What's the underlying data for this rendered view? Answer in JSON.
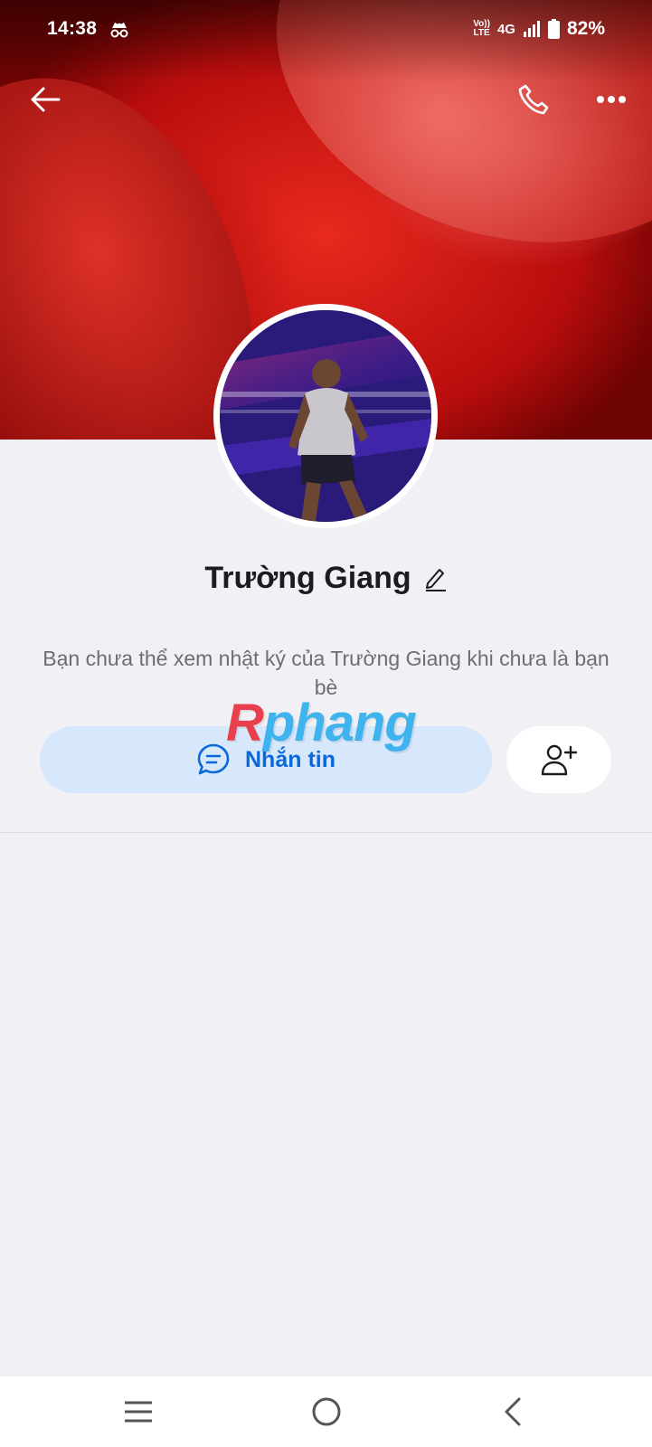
{
  "status_bar": {
    "time": "14:38",
    "volte_line1": "Vo))",
    "volte_line2": "LTE",
    "network": "4G",
    "battery": "82%",
    "icons": [
      "incognito-icon",
      "signal-icon",
      "battery-icon"
    ]
  },
  "header": {
    "icons": [
      "back-arrow-icon",
      "phone-call-icon",
      "more-options-icon"
    ]
  },
  "profile": {
    "name": "Trường Giang",
    "privacy_note": "Bạn chưa thể xem nhật ký của Trường Giang khi chưa là bạn bè",
    "message_button_label": "Nhắn tin",
    "add_friend_icon": "add-friend-icon"
  },
  "watermark": {
    "first": "R",
    "rest": "phang"
  },
  "nav_bar": {
    "icons": [
      "menu-icon",
      "home-icon",
      "back-icon"
    ]
  },
  "colors": {
    "accent": "#0a68d8",
    "message_button_bg": "#d7e8fd",
    "page_bg": "#f0f0f5"
  }
}
